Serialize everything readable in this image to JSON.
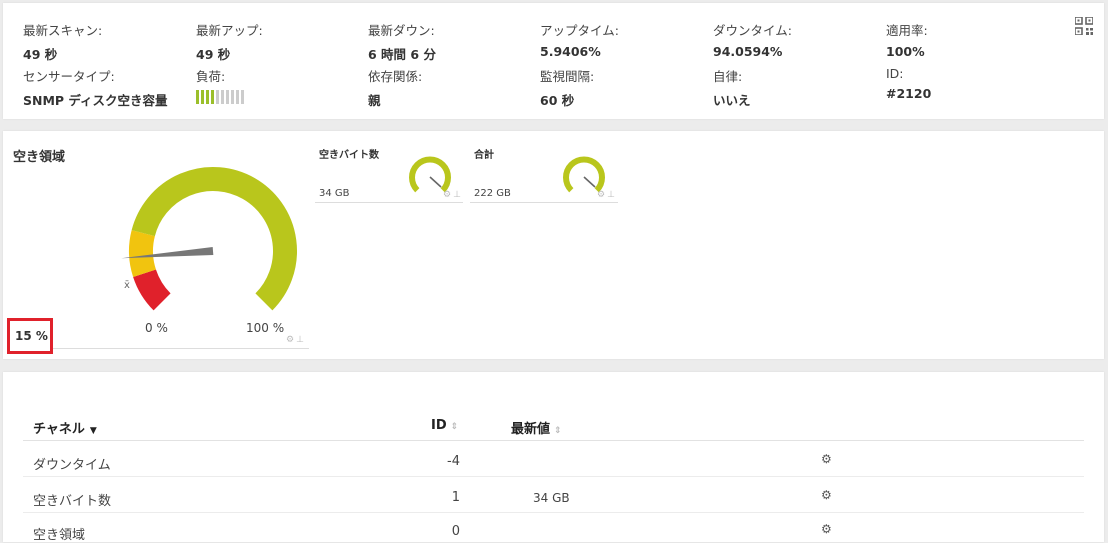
{
  "summary": {
    "last_scan": {
      "label": "最新スキャン:",
      "value": "49 秒"
    },
    "last_up": {
      "label": "最新アップ:",
      "value": "49 秒"
    },
    "last_down": {
      "label": "最新ダウン:",
      "value": "6 時間 6 分"
    },
    "uptime": {
      "label": "アップタイム:",
      "value": "5.9406%"
    },
    "downtime": {
      "label": "ダウンタイム:",
      "value": "94.0594%"
    },
    "coverage": {
      "label": "適用率:",
      "value": "100%"
    },
    "sensor_type": {
      "label": "センサータイプ:",
      "value": "SNMP ディスク空き容量"
    },
    "load": {
      "label": "負荷:",
      "level": 0.42
    },
    "dependency": {
      "label": "依存関係:",
      "value": "親"
    },
    "interval": {
      "label": "監視間隔:",
      "value": "60 秒"
    },
    "autonomous": {
      "label": "自律:",
      "value": "いいえ"
    },
    "id": {
      "label": "ID:",
      "value": "#2120"
    }
  },
  "gauge": {
    "title": "空き領域",
    "min_label": "0 %",
    "max_label": "100 %",
    "value_text": "15 %",
    "value_pct": 15,
    "avg_marker": "x̄",
    "colors": {
      "ok": "#b9c61c",
      "warn": "#f1c40f",
      "error": "#e0212b",
      "needle": "#777777"
    }
  },
  "mini_gauges": [
    {
      "title": "空きバイト数",
      "value": "34 GB"
    },
    {
      "title": "合計",
      "value": "222 GB"
    }
  ],
  "table": {
    "headers": {
      "channel": "チャネル",
      "id": "ID",
      "last_value": "最新値"
    },
    "rows": [
      {
        "channel": "ダウンタイム",
        "id": "-4",
        "last_value": ""
      },
      {
        "channel": "空きバイト数",
        "id": "1",
        "last_value": "34 GB"
      },
      {
        "channel": "空き領域",
        "id": "0",
        "last_value": ""
      }
    ]
  }
}
